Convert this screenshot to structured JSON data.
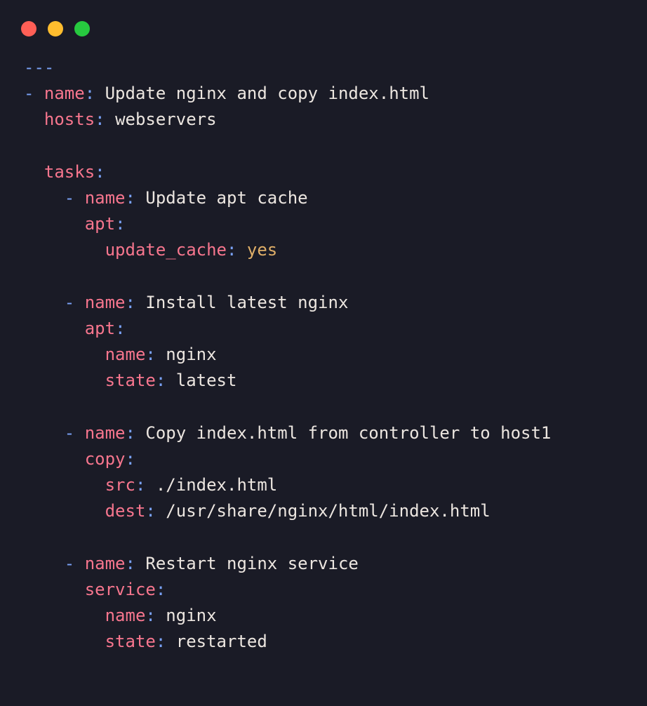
{
  "yaml": {
    "doc_start": "---",
    "dash": "-",
    "colon": ":",
    "play": {
      "name_key": "name",
      "name_val": "Update nginx and copy index.html",
      "hosts_key": "hosts",
      "hosts_val": "webservers",
      "tasks_key": "tasks"
    },
    "tasks": [
      {
        "name_key": "name",
        "name_val": "Update apt cache",
        "module_key": "apt",
        "params": [
          {
            "key": "update_cache",
            "val": "yes",
            "val_is_bool": true
          }
        ]
      },
      {
        "name_key": "name",
        "name_val": "Install latest nginx",
        "module_key": "apt",
        "params": [
          {
            "key": "name",
            "val": "nginx"
          },
          {
            "key": "state",
            "val": "latest"
          }
        ]
      },
      {
        "name_key": "name",
        "name_val": "Copy index.html from controller to host1",
        "module_key": "copy",
        "params": [
          {
            "key": "src",
            "val": "./index.html"
          },
          {
            "key": "dest",
            "val": "/usr/share/nginx/html/index.html"
          }
        ]
      },
      {
        "name_key": "name",
        "name_val": "Restart nginx service",
        "module_key": "service",
        "params": [
          {
            "key": "name",
            "val": "nginx"
          },
          {
            "key": "state",
            "val": "restarted"
          }
        ]
      }
    ]
  }
}
